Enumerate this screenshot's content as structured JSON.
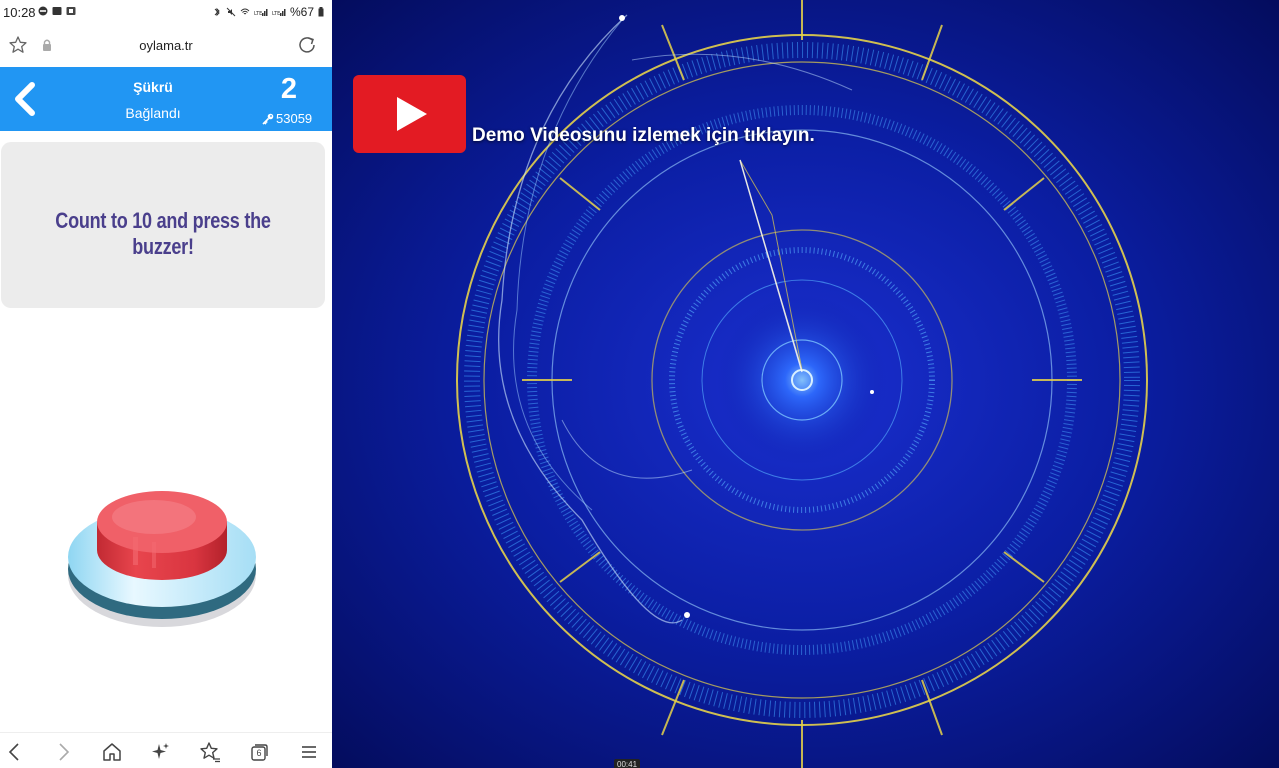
{
  "status_bar": {
    "time": "10:28",
    "battery": "%67"
  },
  "browser": {
    "url": "oylama.tr"
  },
  "header": {
    "player_name": "Şükrü",
    "connection_status": "Bağlandı",
    "score": "2",
    "room_code": "53059"
  },
  "question": {
    "text": "Count to 10 and press the buzzer!"
  },
  "buzzer": {
    "top_color": "#e8454d",
    "base_color": "#bfe8f8"
  },
  "browser_nav": {
    "tab_count": "6",
    "icons": [
      "chevron-left-icon",
      "chevron-right-icon",
      "home-icon",
      "sparkle-icon",
      "favorites-icon",
      "tabs-icon",
      "menu-icon"
    ]
  },
  "video": {
    "caption": "Demo Videosunu izlemek için tıklayın.",
    "timestamp": "00:41",
    "play_button_color": "#e31b23",
    "accent_colors": [
      "#e6d24a",
      "#2f8bff",
      "#0a1a8a"
    ]
  },
  "theme": {
    "header_color": "#2196f3",
    "question_color": "#4a3f8c"
  }
}
